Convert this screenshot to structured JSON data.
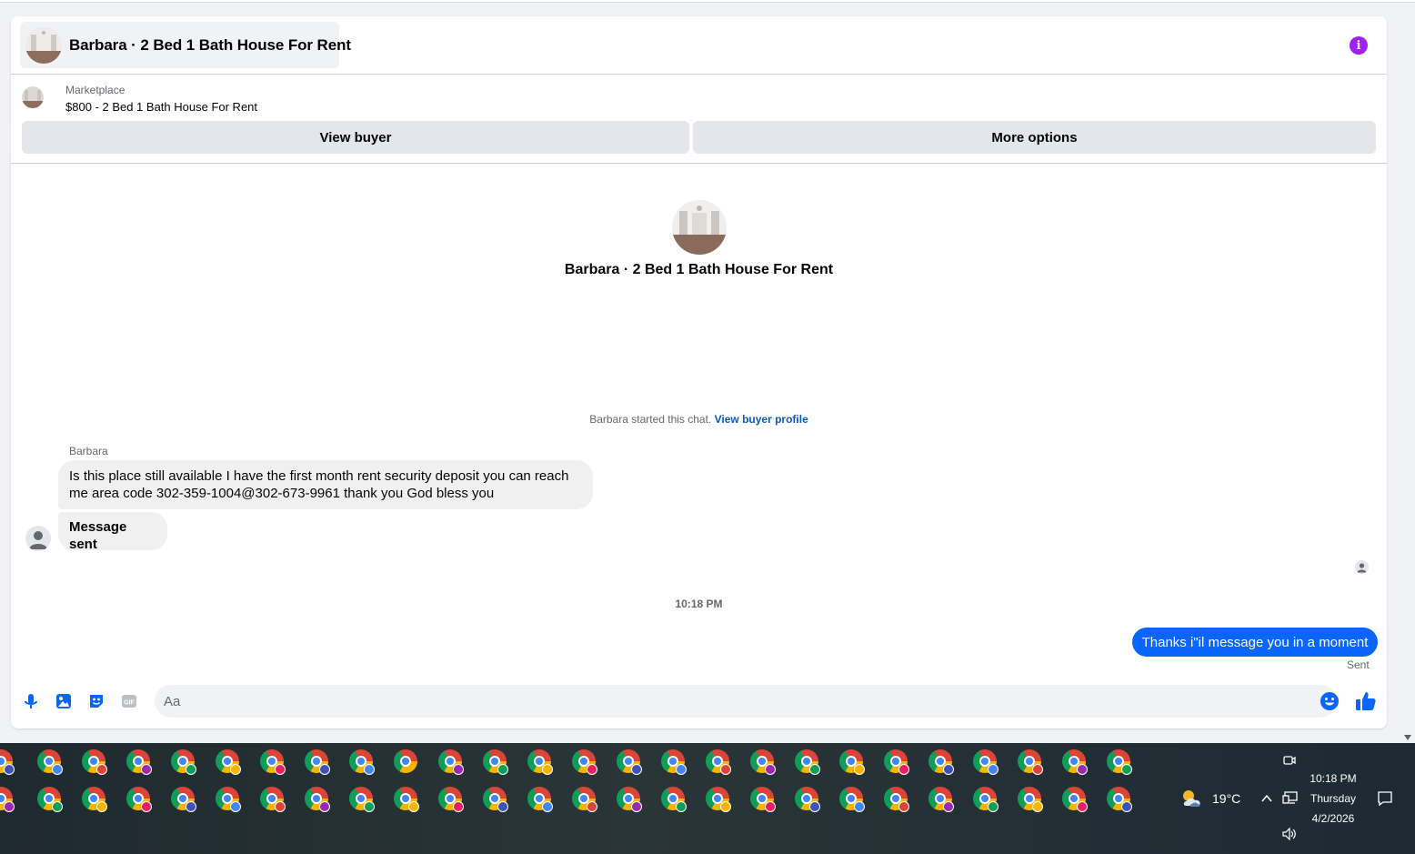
{
  "header": {
    "title": "Barbara · 2 Bed 1 Bath House For Rent",
    "info_icon": "info-icon",
    "accent": "#a020f0"
  },
  "listing": {
    "source": "Marketplace",
    "price_title": "$800 - 2 Bed 1 Bath House For Rent"
  },
  "actions": {
    "view_buyer": "View buyer",
    "more_options": "More options"
  },
  "chat": {
    "center_title": "Barbara · 2 Bed 1 Bath House For Rent",
    "started_text": "Barbara started this chat.",
    "view_profile_link": "View buyer profile",
    "sender_name": "Barbara",
    "incoming": [
      "Is this place still available I have the first month rent security deposit you can reach me area code 302-359-1004@302-673-9961 thank you God bless you",
      "Message sent"
    ],
    "timestamp": "10:18 PM",
    "outgoing": "Thanks i\"il message you in a moment",
    "status": "Sent",
    "outgoing_color": "#0866ff"
  },
  "composer": {
    "placeholder": "Aa",
    "icons": [
      "microphone-icon",
      "image-icon",
      "sticker-icon",
      "gif-icon",
      "emoji-icon",
      "thumbs-up-icon"
    ],
    "gif_label": "GIF"
  },
  "taskbar": {
    "weather_temp": "19°C",
    "time": "10:18 PM",
    "day": "Thursday",
    "date": "4/2/2026"
  }
}
